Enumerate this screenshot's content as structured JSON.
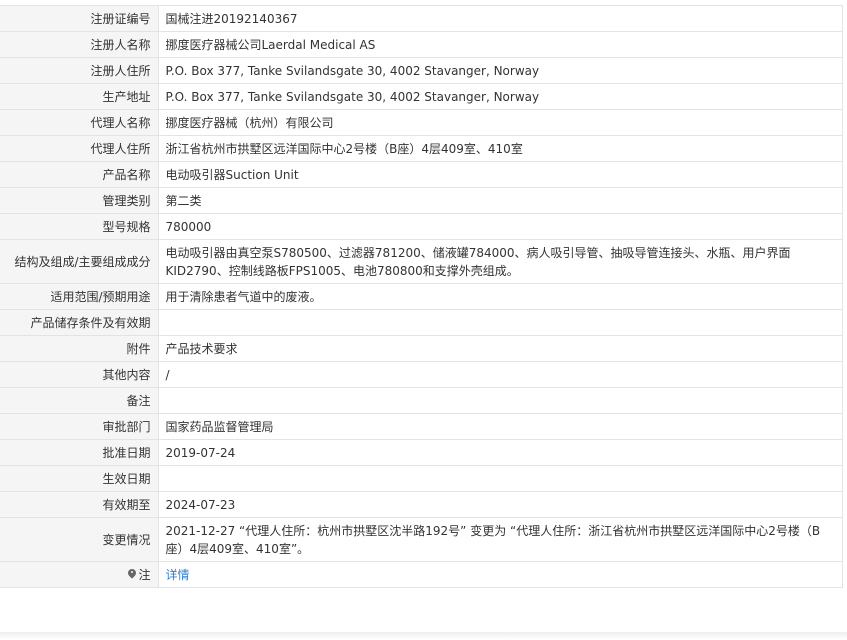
{
  "rows": [
    {
      "label": "注册证编号",
      "value": "国械注进20192140367"
    },
    {
      "label": "注册人名称",
      "value": "挪度医疗器械公司Laerdal Medical AS"
    },
    {
      "label": "注册人住所",
      "value": "P.O. Box 377, Tanke Svilandsgate 30, 4002 Stavanger, Norway"
    },
    {
      "label": "生产地址",
      "value": "P.O. Box 377, Tanke Svilandsgate 30, 4002 Stavanger, Norway"
    },
    {
      "label": "代理人名称",
      "value": "挪度医疗器械（杭州）有限公司"
    },
    {
      "label": "代理人住所",
      "value": "浙江省杭州市拱墅区远洋国际中心2号楼（B座）4层409室、410室"
    },
    {
      "label": "产品名称",
      "value": "电动吸引器Suction Unit"
    },
    {
      "label": "管理类别",
      "value": "第二类"
    },
    {
      "label": "型号规格",
      "value": "780000"
    },
    {
      "label": "结构及组成/主要组成成分",
      "value": "电动吸引器由真空泵S780500、过滤器781200、储液罐784000、病人吸引导管、抽吸导管连接头、水瓶、用户界面KID2790、控制线路板FPS1005、电池780800和支撑外壳组成。"
    },
    {
      "label": "适用范围/预期用途",
      "value": "用于清除患者气道中的废液。"
    },
    {
      "label": "产品储存条件及有效期",
      "value": ""
    },
    {
      "label": "附件",
      "value": "产品技术要求"
    },
    {
      "label": "其他内容",
      "value": "/"
    },
    {
      "label": "备注",
      "value": ""
    },
    {
      "label": "审批部门",
      "value": "国家药品监督管理局"
    },
    {
      "label": "批准日期",
      "value": "2019-07-24"
    },
    {
      "label": "生效日期",
      "value": ""
    },
    {
      "label": "有效期至",
      "value": "2024-07-23"
    },
    {
      "label": "变更情况",
      "value": "2021-12-27 “代理人住所：杭州市拱墅区沈半路192号” 变更为 “代理人住所：浙江省杭州市拱墅区远洋国际中心2号楼（B座）4层409室、410室”。"
    }
  ],
  "note": {
    "label": "注",
    "link": "详情",
    "icon": "map-pin-icon"
  },
  "colors": {
    "label_bg": "#f5f5f5",
    "border": "#e3e3e3",
    "link": "#2b7fd4"
  }
}
